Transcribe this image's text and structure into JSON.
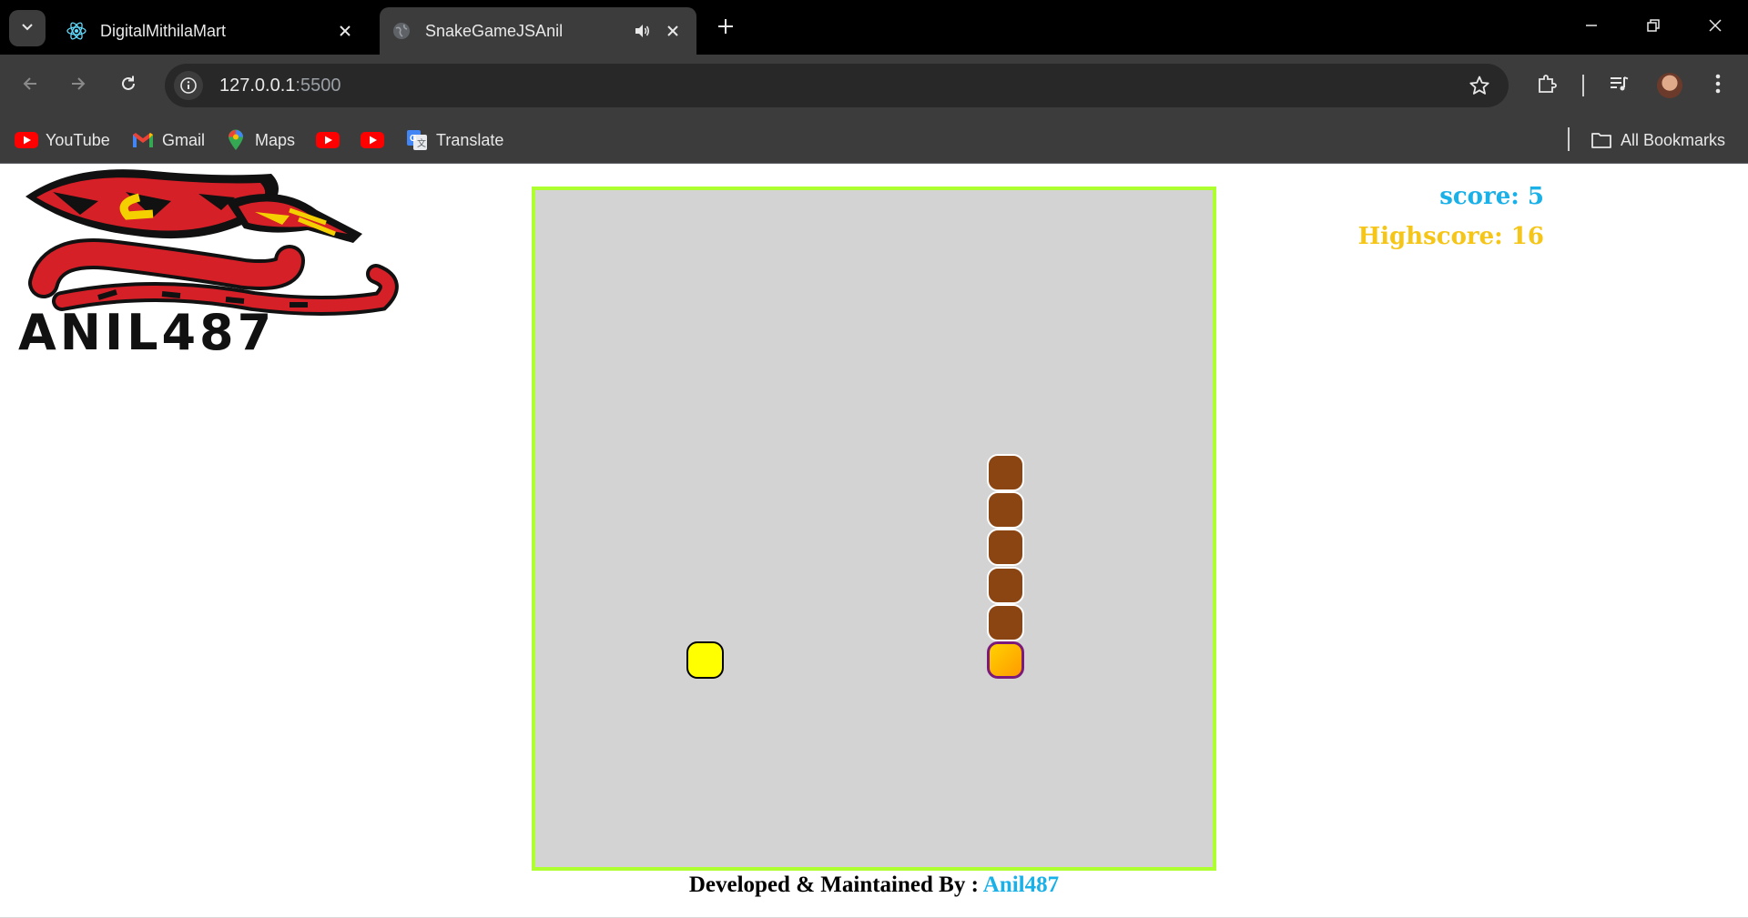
{
  "browser": {
    "tabs": [
      {
        "title": "DigitalMithilaMart",
        "active": false,
        "favicon": "react-icon"
      },
      {
        "title": "SnakeGameJSAnil",
        "active": true,
        "favicon": "globe-icon",
        "audio": true
      }
    ],
    "url_host": "127.0.0.1",
    "url_port": ":5500",
    "bookmarks": [
      {
        "label": "YouTube",
        "icon": "youtube-icon"
      },
      {
        "label": "Gmail",
        "icon": "gmail-icon"
      },
      {
        "label": "Maps",
        "icon": "maps-icon"
      },
      {
        "label": "",
        "icon": "youtube-icon"
      },
      {
        "label": "",
        "icon": "youtube-icon"
      },
      {
        "label": "Translate",
        "icon": "translate-icon"
      }
    ],
    "all_bookmarks_label": "All Bookmarks"
  },
  "game": {
    "logo_text": "ANIL487",
    "score_label": "score: 5",
    "highscore_label": "Highscore: 16",
    "grid_size": 18,
    "snake": [
      {
        "x": 13,
        "y": 13
      },
      {
        "x": 13,
        "y": 12
      },
      {
        "x": 13,
        "y": 11
      },
      {
        "x": 13,
        "y": 10
      },
      {
        "x": 13,
        "y": 9
      },
      {
        "x": 13,
        "y": 8
      }
    ],
    "food": {
      "x": 5,
      "y": 13
    },
    "colors": {
      "board": "#d3d3d3",
      "board_border": "#adff2f",
      "snake_body": "#8b4513",
      "snake_head": "#ffb000",
      "food": "#ffff00",
      "score": "#1ab0e8",
      "highscore": "#f5c518"
    }
  },
  "footer": {
    "prefix": "Developed & Maintained By : ",
    "author": "Anil487"
  }
}
